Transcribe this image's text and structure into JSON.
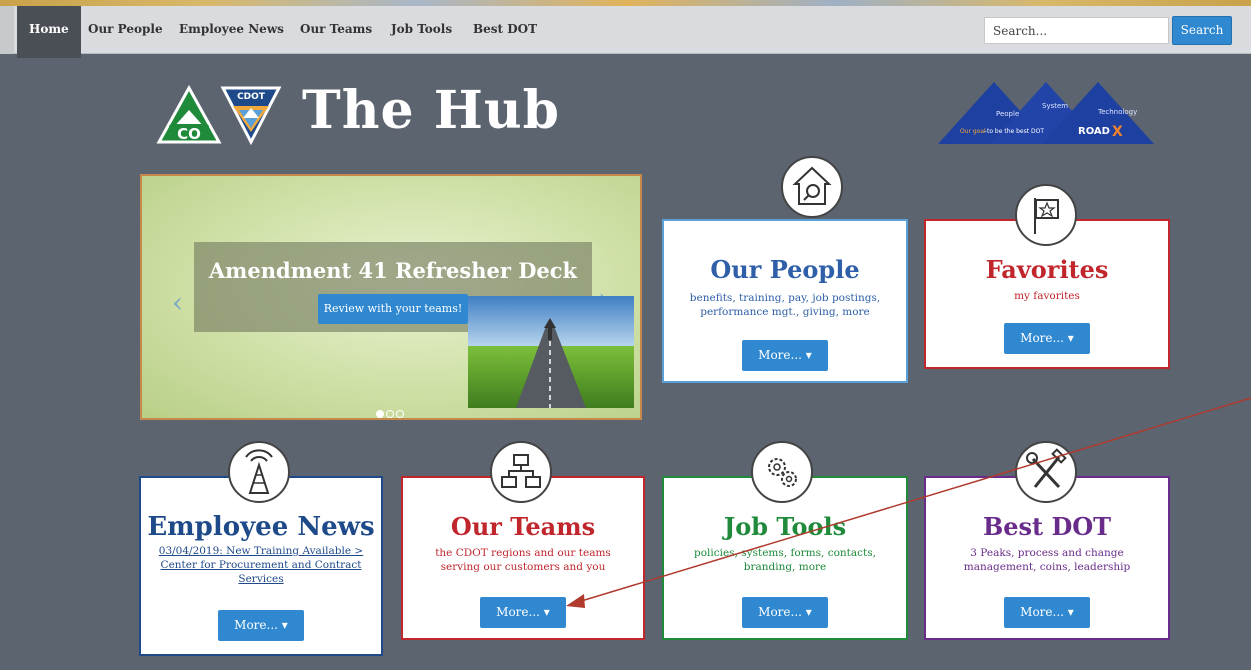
{
  "nav": {
    "items": [
      "Home",
      "Our People",
      "Employee News",
      "Our Teams",
      "Job Tools",
      "Best DOT"
    ],
    "search_placeholder": "Search...",
    "search_button": "Search"
  },
  "header": {
    "title": "The Hub",
    "co_logo_text": "CO",
    "cdot_logo_text": "CDOT",
    "roadx": {
      "peaks": [
        "People",
        "System",
        "Technology"
      ],
      "tagline_goal": "Our goal",
      "tagline_rest": "–to be the best DOT",
      "brand": "ROAD",
      "brand_x": "X"
    }
  },
  "carousel": {
    "title": "Amendment 41 Refresher Deck",
    "button": "Review with your teams!",
    "prev": "‹",
    "next": "›",
    "active_slide_index": 0
  },
  "cards": {
    "our_people": {
      "title": "Our People",
      "desc": "benefits, training, pay, job postings, performance mgt., giving, more",
      "button": "More... ▾",
      "color": "#2e5fa8",
      "icon": "house-magnifier-icon"
    },
    "favorites": {
      "title": "Favorites",
      "desc": "my favorites",
      "button": "More... ▾",
      "color": "#c0262c",
      "icon": "star-flag-icon"
    },
    "employee_news": {
      "title": "Employee News",
      "desc": "03/04/2019: New Training Available > Center for Procurement and Contract Services",
      "button": "More... ▾",
      "color": "#1f4a8a",
      "icon": "radio-tower-icon"
    },
    "our_teams": {
      "title": "Our Teams",
      "desc": "the CDOT regions and our teams serving our customers and you",
      "button": "More... ▾",
      "color": "#c0262c",
      "icon": "org-chart-icon"
    },
    "job_tools": {
      "title": "Job Tools",
      "desc": "policies, systems, forms, contacts, branding, more",
      "button": "More... ▾",
      "color": "#1e8a3a",
      "icon": "gears-icon"
    },
    "best_dot": {
      "title": "Best DOT",
      "desc": "3 Peaks, process and change management, coins, leadership",
      "button": "More... ▾",
      "color": "#6a2c8a",
      "icon": "wrench-hammer-icon"
    }
  },
  "colors": {
    "accent_blue": "#2f88d0",
    "background": "#5c6470",
    "annotation_arrow": "#b03a2e"
  }
}
